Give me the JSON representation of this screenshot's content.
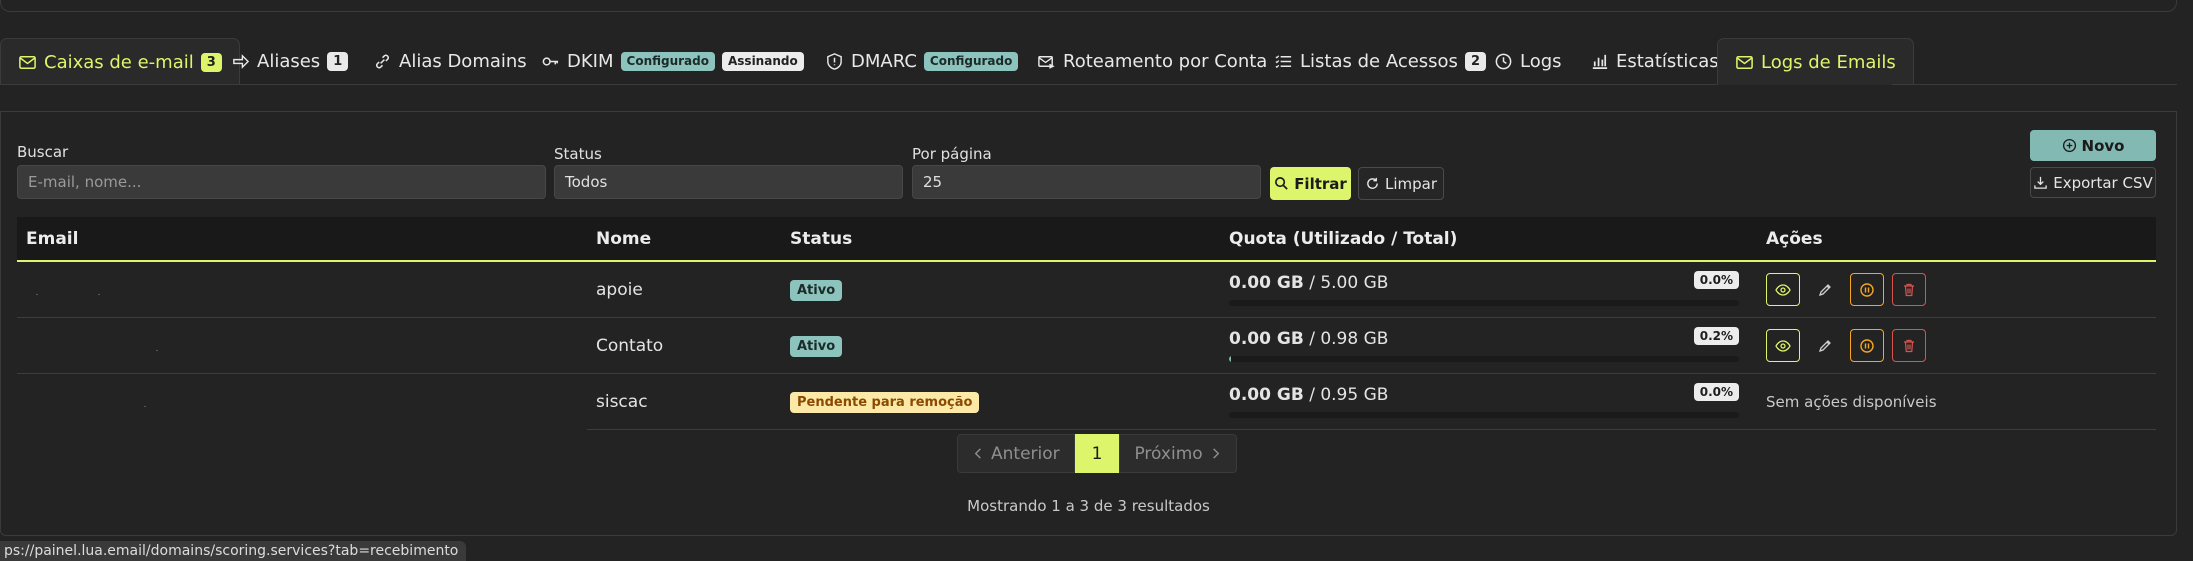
{
  "tabs": [
    {
      "label": "Caixas de e-mail",
      "icon": "mailbox-icon",
      "badge": "3"
    },
    {
      "label": "Aliases",
      "icon": "arrow-right-icon",
      "badge": "1"
    },
    {
      "label": "Alias Domains",
      "icon": "link-icon"
    },
    {
      "label": "DKIM",
      "icon": "key-icon",
      "badges": [
        "Configurado",
        "Assinando"
      ]
    },
    {
      "label": "DMARC",
      "icon": "shield-icon",
      "badges": [
        "Configurado"
      ]
    },
    {
      "label": "Roteamento por Conta",
      "icon": "envelope-route-icon"
    },
    {
      "label": "Listas de Acessos",
      "icon": "list-icon",
      "badge": "2"
    },
    {
      "label": "Logs",
      "icon": "clock-icon"
    },
    {
      "label": "Estatísticas",
      "icon": "bar-chart-icon"
    },
    {
      "label": "Logs de Emails",
      "icon": "mail-log-icon"
    }
  ],
  "filters": {
    "search_label": "Buscar",
    "search_placeholder": "E-mail, nome...",
    "status_label": "Status",
    "status_value": "Todos",
    "per_page_label": "Por página",
    "per_page_value": "25",
    "filter_button": "Filtrar",
    "clear_button": "Limpar"
  },
  "toolbar": {
    "new_button": "Novo",
    "export_button": "Exportar CSV"
  },
  "table": {
    "headers": [
      "Email",
      "Nome",
      "Status",
      "Quota (Utilizado / Total)",
      "Ações"
    ],
    "rows": [
      {
        "email": "",
        "nome": "apoie",
        "status": "Ativo",
        "status_kind": "ok",
        "used": "0.00 GB",
        "total": "/ 5.00 GB",
        "pct": "0.0%",
        "fill": 0.0,
        "actions": true
      },
      {
        "email": "",
        "nome": "Contato",
        "status": "Ativo",
        "status_kind": "ok",
        "used": "0.00 GB",
        "total": "/ 0.98 GB",
        "pct": "0.2%",
        "fill": 0.002,
        "actions": true
      },
      {
        "email": "",
        "nome": "siscac",
        "status": "Pendente para remoção",
        "status_kind": "warn",
        "used": "0.00 GB",
        "total": "/ 0.95 GB",
        "pct": "0.0%",
        "fill": 0.0,
        "actions": false,
        "no_actions_text": "Sem ações disponíveis"
      }
    ]
  },
  "pagination": {
    "prev": "Anterior",
    "current": "1",
    "next": "Próximo",
    "summary": "Mostrando 1 a 3 de 3 resultados"
  },
  "statusbar": {
    "url": "ps://painel.lua.email/domains/scoring.services?tab=recebimento"
  },
  "colors": {
    "accent": "#dcf56a",
    "teal": "#82b9b2",
    "warn": "#f5a623",
    "danger": "#d9534f"
  }
}
